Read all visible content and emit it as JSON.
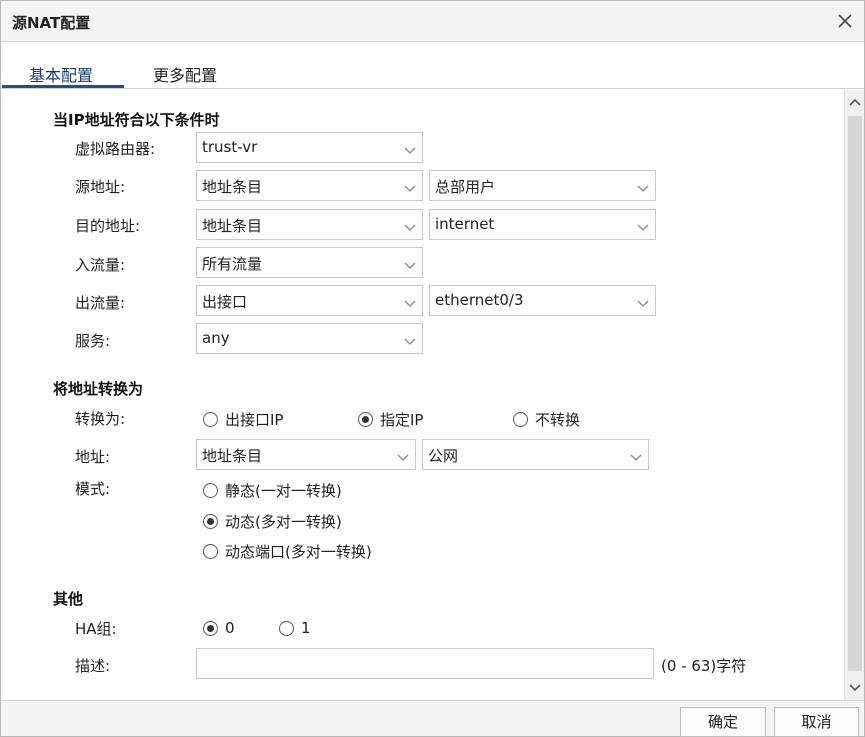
{
  "dialog": {
    "title": "源NAT配置"
  },
  "tabs": [
    {
      "label": "基本配置",
      "active": true
    },
    {
      "label": "更多配置",
      "active": false
    }
  ],
  "conditions": {
    "section_title": "当IP地址符合以下条件时",
    "virtual_router": {
      "label": "虚拟路由器:",
      "value": "trust-vr"
    },
    "source": {
      "label": "源地址:",
      "type": "地址条目",
      "value": "总部用户"
    },
    "destination": {
      "label": "目的地址:",
      "type": "地址条目",
      "value": "internet"
    },
    "ingress": {
      "label": "入流量:",
      "value": "所有流量"
    },
    "egress": {
      "label": "出流量:",
      "type": "出接口",
      "value": "ethernet0/3"
    },
    "service": {
      "label": "服务:",
      "value": "any"
    }
  },
  "translate": {
    "section_title": "将地址转换为",
    "to_label": "转换为:",
    "to_options": [
      {
        "label": "出接口IP",
        "selected": false
      },
      {
        "label": "指定IP",
        "selected": true
      },
      {
        "label": "不转换",
        "selected": false
      }
    ],
    "address": {
      "label": "地址:",
      "type": "地址条目",
      "value": "公网"
    },
    "mode_label": "模式:",
    "mode_options": [
      {
        "label": "静态(一对一转换)",
        "selected": false
      },
      {
        "label": "动态(多对一转换)",
        "selected": true
      },
      {
        "label": "动态端口(多对一转换)",
        "selected": false
      }
    ]
  },
  "other": {
    "section_title": "其他",
    "ha_label": "HA组:",
    "ha_options": [
      {
        "label": "0",
        "selected": true
      },
      {
        "label": "1",
        "selected": false
      }
    ],
    "desc_label": "描述:",
    "desc_value": "",
    "desc_hint": "(0 - 63)字符"
  },
  "footer": {
    "ok_label": "确定",
    "cancel_label": "取消"
  },
  "icons": {
    "close": "close-icon",
    "caret": "chevron-down-icon",
    "scroll_up": "chevron-up-icon",
    "scroll_down": "chevron-down-icon"
  }
}
